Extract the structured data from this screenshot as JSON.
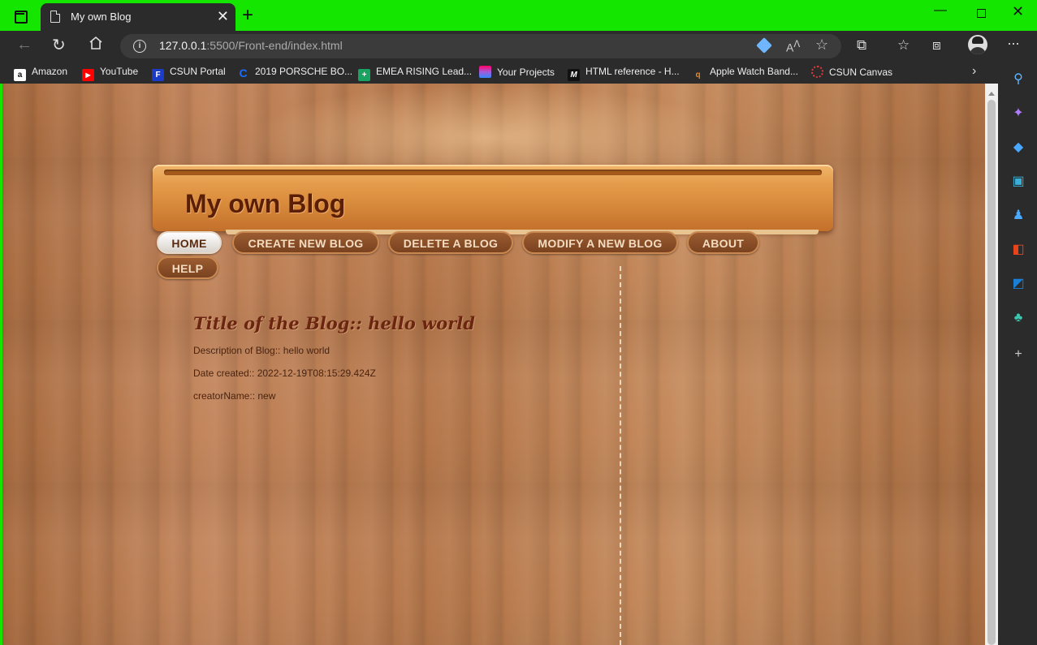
{
  "browser": {
    "tab": {
      "title": "My own Blog",
      "close_label": "✕"
    },
    "new_tab_label": "+",
    "window_controls": {
      "minimize": "—",
      "close": "✕"
    },
    "address": {
      "host": "127.0.0.1",
      "rest": ":5500/Front-end/index.html"
    },
    "favorites": [
      {
        "label": "Amazon",
        "icon": "amazon-icon",
        "color": "#ffffff"
      },
      {
        "label": "YouTube",
        "icon": "youtube-icon",
        "color": "#ff0000"
      },
      {
        "label": "CSUN Portal",
        "icon": "csun-portal-icon",
        "color": "#1a3cc8"
      },
      {
        "label": "2019 PORSCHE BO...",
        "icon": "porsche-icon",
        "color": "#1a6cff"
      },
      {
        "label": "EMEA RISING Lead...",
        "icon": "sheets-icon",
        "color": "#1aa260"
      },
      {
        "label": "Your Projects",
        "icon": "projects-icon",
        "color": "#a65bd6"
      },
      {
        "label": "HTML reference - H...",
        "icon": "mdn-icon",
        "color": "#111111"
      },
      {
        "label": "Apple Watch Band...",
        "icon": "apple-watch-icon",
        "color": "#e08a2c"
      },
      {
        "label": "CSUN Canvas",
        "icon": "canvas-icon",
        "color": "#e23b3b"
      }
    ]
  },
  "page": {
    "site_title": "My own Blog",
    "nav": [
      {
        "label": "HOME",
        "active": true
      },
      {
        "label": "CREATE NEW BLOG",
        "active": false
      },
      {
        "label": "DELETE A BLOG",
        "active": false
      },
      {
        "label": "MODIFY A NEW BLOG",
        "active": false
      },
      {
        "label": "ABOUT",
        "active": false
      },
      {
        "label": "HELP",
        "active": false
      }
    ],
    "post": {
      "title": "Title of the Blog:: hello world",
      "description": "Description of Blog:: hello world",
      "date_created": "Date created:: 2022-12-19T08:15:29.424Z",
      "creator": "creatorName:: new"
    }
  },
  "colors": {
    "tab_strip": "#15e600",
    "chrome": "#2b2b2b",
    "title_text": "#5a1f06",
    "post_title": "#6b2510"
  }
}
